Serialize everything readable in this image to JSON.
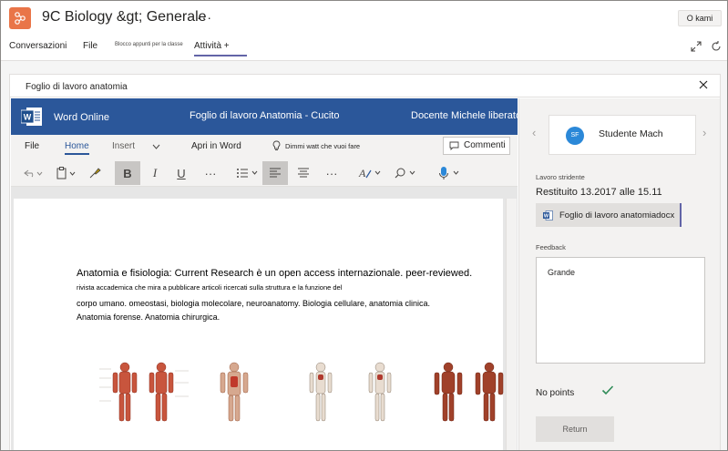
{
  "team": {
    "title": "9C Biology &gt; Generale",
    "more": "···",
    "okami_label": "O kami",
    "icon": "team-hub-icon"
  },
  "tabs": {
    "conversazioni": "Conversazioni",
    "file": "File",
    "blocco": "Blocco appunti per la classe",
    "attivita": "Attività",
    "add": "+"
  },
  "panel": {
    "title": "Foglio di lavoro anatomia"
  },
  "word": {
    "app_name": "Word Online",
    "doc_title": "Foglio di lavoro Anatomia -   Cucito",
    "user_name": "Docente Michele liberato",
    "ribbon_tabs": {
      "file": "File",
      "home": "Home",
      "insert": "Insert",
      "open_in_word": "Apri in Word",
      "tell_me": "Dimmi watt che vuoi fare",
      "comments": "Commenti"
    },
    "document": {
      "heading": "Anatomia e fisiologia: Current Research è un open access internazionale. peer-reviewed.",
      "line1": "rivista accademica che mira a pubblicare articoli ricercati sulla struttura e la funzione del",
      "line2": "corpo umano. omeostasi, biologia molecolare, neuroanatomy. Biologia cellulare, anatomia clinica.",
      "line3": "Anatomia forense. Anatomia chirurgica."
    }
  },
  "right_pane": {
    "student_initials": "SF",
    "student_name": "Studente Mach",
    "work_label": "Lavoro stridente",
    "returned": "Restituito 13.2017 alle 15.11",
    "file_name": "Foglio di lavoro anatomiadocx",
    "feedback_label": "Feedback",
    "feedback_text": "Grande",
    "points": "No points",
    "return_button": "Return"
  },
  "colors": {
    "word_blue": "#2b579a",
    "teams_purple": "#6264a7",
    "team_icon": "#e97548",
    "avatar": "#2b88d8",
    "check": "#2e8b57"
  }
}
